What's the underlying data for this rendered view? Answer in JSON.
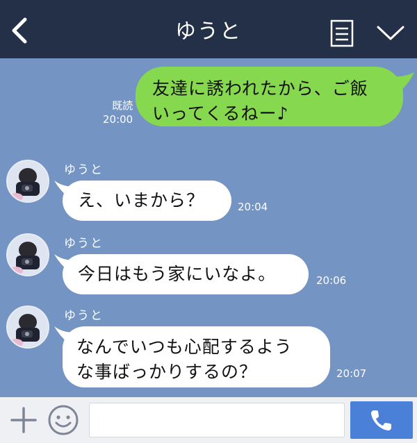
{
  "header": {
    "title": "ゆうと",
    "back_icon": "chevron-left-icon",
    "menu_icon": "document-list-icon",
    "collapse_icon": "chevron-down-icon",
    "background": "#243047"
  },
  "chat": {
    "background": "#7494c4",
    "outgoing": {
      "line1": "友達に誘われたから、ご飯",
      "line2": "いってくるねー♪",
      "read_label": "既読",
      "time": "20:00",
      "color": "#86d84f"
    },
    "incoming": [
      {
        "sender": "ゆうと",
        "lines": [
          "え、いまから？"
        ],
        "time": "20:04"
      },
      {
        "sender": "ゆうと",
        "lines": [
          "今日はもう家にいなよ。"
        ],
        "time": "20:06"
      },
      {
        "sender": "ゆうと",
        "lines": [
          "なんでいつも心配するよう",
          "な事ばっかりするの？"
        ],
        "time": "20:07"
      }
    ]
  },
  "input_bar": {
    "plus_icon": "plus-icon",
    "emoji_icon": "smiley-icon",
    "placeholder": "",
    "call_icon": "phone-icon",
    "call_color": "#4a80d8"
  }
}
